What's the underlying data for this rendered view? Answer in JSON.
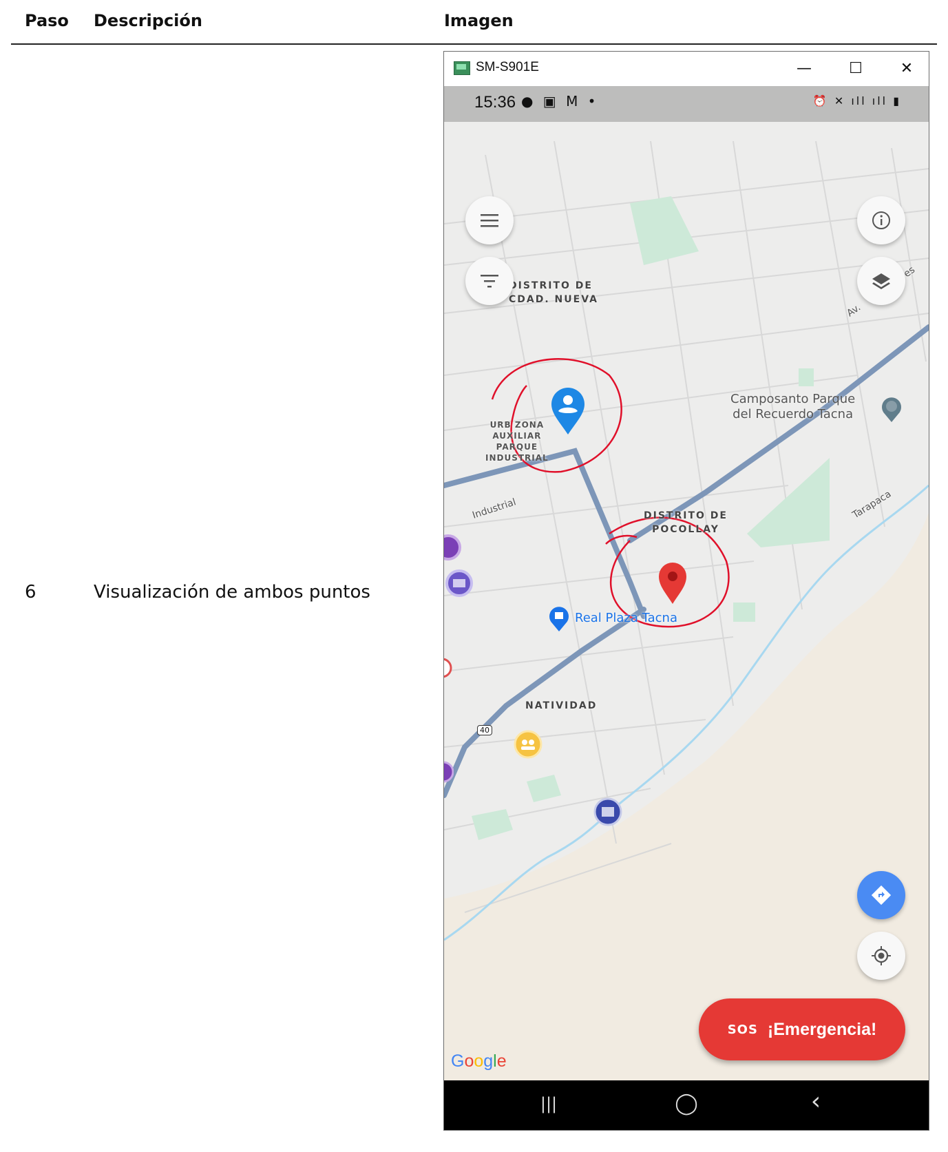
{
  "table": {
    "headers": [
      "Paso",
      "Descripción",
      "Imagen"
    ],
    "row": {
      "step": "6",
      "description": "Visualización de ambos puntos"
    }
  },
  "window": {
    "title": "SM-S901E",
    "minimize": "—",
    "maximize": "☐",
    "close": "✕"
  },
  "statusbar": {
    "time": "15:36",
    "left_icons": "● ▣ M •",
    "right_icons": "⏰ ✕ ıll ıll ▮"
  },
  "map": {
    "district_1": [
      "DISTRITO DE",
      "CDAD. NUEVA"
    ],
    "zone": [
      "URB ZONA",
      "AUXILIAR",
      "PARQUE",
      "INDUSTRIAL"
    ],
    "district_2": [
      "DISTRITO DE",
      "POCOLLAY"
    ],
    "natividad": "NATIVIDAD",
    "street_industrial": "Industrial",
    "street_tarapaca": "Tarapaca",
    "street_av": "Av.",
    "street_av_suffix": "es",
    "route_badge": "40",
    "poi_cemetery": [
      "Camposanto Parque",
      "del Recuerdo Tacna"
    ],
    "poi_mall": "Real Plaza Tacna",
    "google": "Google"
  },
  "buttons": {
    "menu_icon": "menu-icon",
    "filter_icon": "filter-icon",
    "info_icon": "info-icon",
    "layers_icon": "layers-icon",
    "directions_icon": "directions-icon",
    "locate_icon": "my-location-icon",
    "sos_icon": "SOS",
    "sos_label": "¡Emergencia!"
  },
  "navbar": {
    "recent": "|||",
    "home": "◯",
    "back": "‹"
  },
  "colors": {
    "sos": "#e53935",
    "route": "#7d96b8",
    "user_pin": "#1e88e5",
    "dest_pin": "#e53935",
    "annotation": "#e0102a"
  }
}
